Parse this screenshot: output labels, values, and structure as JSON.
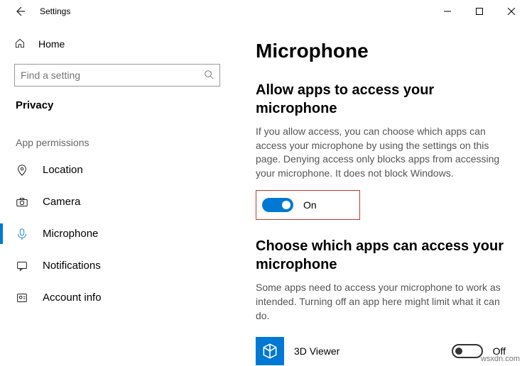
{
  "window": {
    "title": "Settings"
  },
  "sidebar": {
    "home": "Home",
    "search_placeholder": "Find a setting",
    "category": "Privacy",
    "group": "App permissions",
    "items": [
      {
        "label": "Location"
      },
      {
        "label": "Camera"
      },
      {
        "label": "Microphone"
      },
      {
        "label": "Notifications"
      },
      {
        "label": "Account info"
      }
    ]
  },
  "main": {
    "title": "Microphone",
    "section1_heading": "Allow apps to access your microphone",
    "section1_desc": "If you allow access, you can choose which apps can access your microphone by using the settings on this page. Denying access only blocks apps from accessing your microphone. It does not block Windows.",
    "toggle1_state": "On",
    "section2_heading": "Choose which apps can access your microphone",
    "section2_desc": "Some apps need to access your microphone to work as intended. Turning off an app here might limit what it can do.",
    "apps": [
      {
        "name": "3D Viewer",
        "state": "Off"
      }
    ]
  },
  "watermark": "wsxdn.com"
}
